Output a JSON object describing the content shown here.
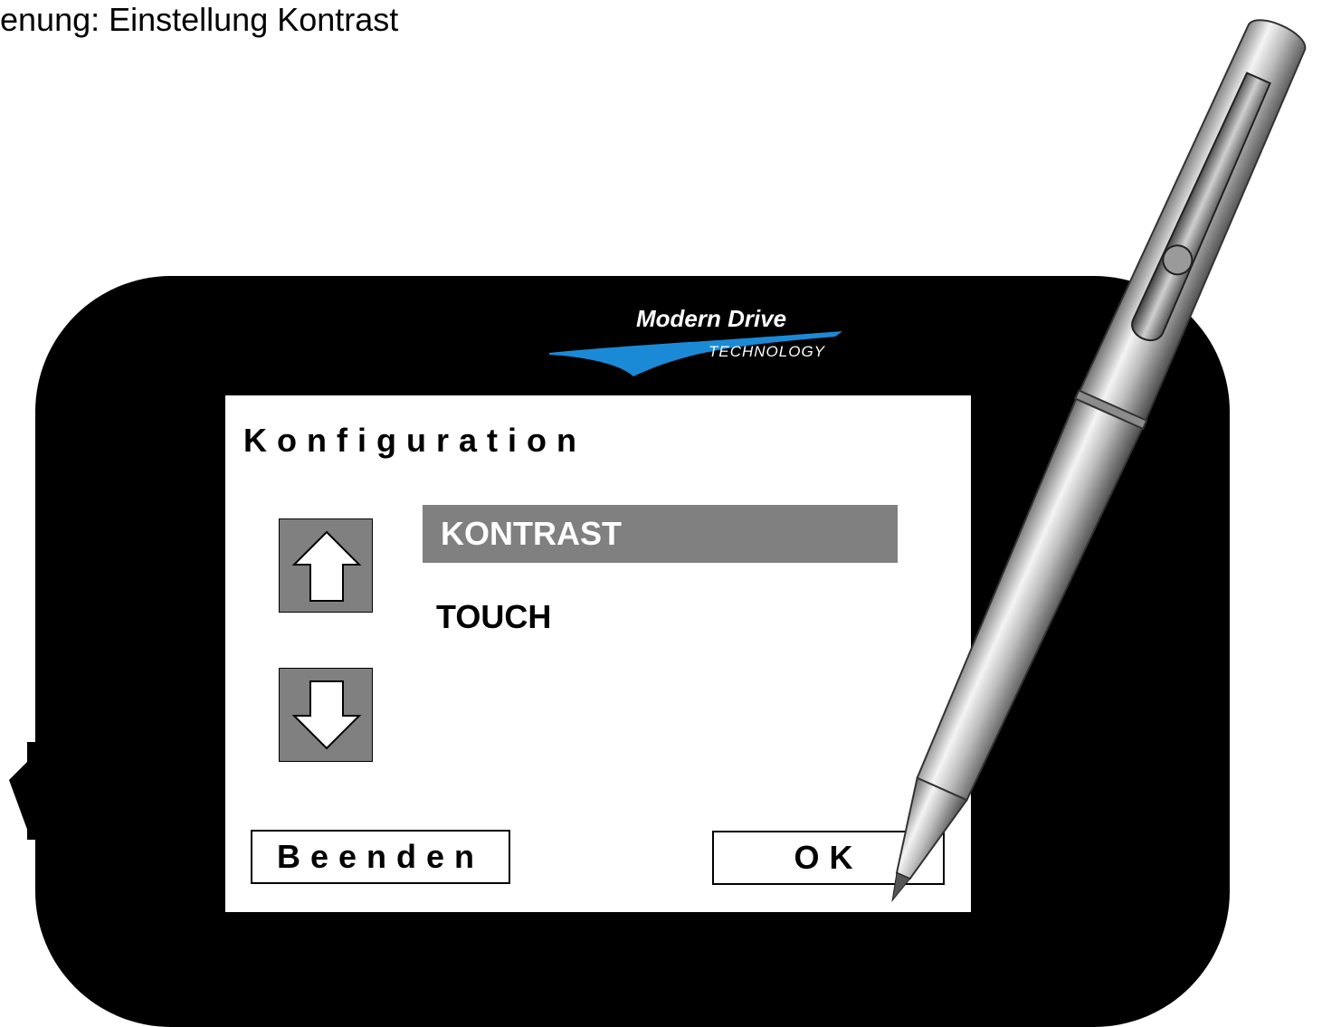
{
  "caption": {
    "text": "enung: Einstellung Kontrast"
  },
  "logo": {
    "name": "Modern Drive",
    "subtitle": "TECHNOLOGY",
    "swoosh_color": "#1b8ad6"
  },
  "screen": {
    "title": "Konfiguration",
    "menu": {
      "items": [
        {
          "label": "KONTRAST",
          "selected": true
        },
        {
          "label": "TOUCH",
          "selected": false
        }
      ]
    },
    "buttons": {
      "up_icon": "arrow-up-icon",
      "down_icon": "arrow-down-icon",
      "exit_label": "Beenden",
      "ok_label": "OK"
    }
  },
  "colors": {
    "device": "#000000",
    "screen": "#ffffff",
    "selection": "#808080",
    "arrow_button": "#808080"
  }
}
